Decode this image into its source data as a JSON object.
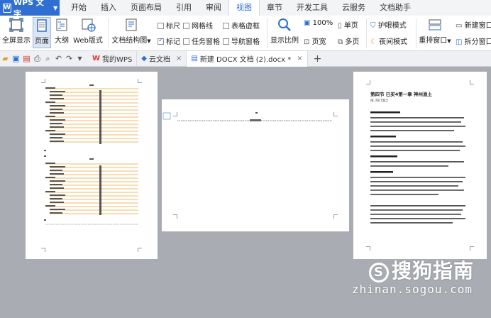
{
  "app": {
    "name": "WPS 文字"
  },
  "menu": [
    "开始",
    "插入",
    "页面布局",
    "引用",
    "审阅",
    "视图",
    "章节",
    "开发工具",
    "云服务",
    "文档助手"
  ],
  "active_menu": "视图",
  "ribbon": {
    "fullscreen": "全屏显示",
    "page": "页面",
    "outline": "大纲",
    "webview": "Web版式",
    "doc_structure": "文档结构图",
    "ruler": "标尺",
    "gridlines": "网格线",
    "table_dash": "表格虚框",
    "marks": "标记",
    "task_pane": "任务窗格",
    "nav_pane": "导航窗格",
    "zoom": "显示比例",
    "zoom_pct": "100%",
    "one_page": "页宽",
    "single": "单页",
    "multi": "多页",
    "eye_mode": "护眼模式",
    "night_mode": "夜间模式",
    "rearrange": "重排窗口",
    "new_window": "新建窗口",
    "split_window": "拆分窗口"
  },
  "tabs": [
    {
      "label": "我的WPS"
    },
    {
      "label": "云文档"
    },
    {
      "label": "新建 DOCX 文档 (2).docx *"
    }
  ],
  "page3": {
    "title": "第四节 已买4第一章  神州渔土",
    "sub": "阳, 阳门渔土"
  },
  "watermark": {
    "brand": "搜狗指南",
    "url": "zhinan.sogou.com"
  }
}
